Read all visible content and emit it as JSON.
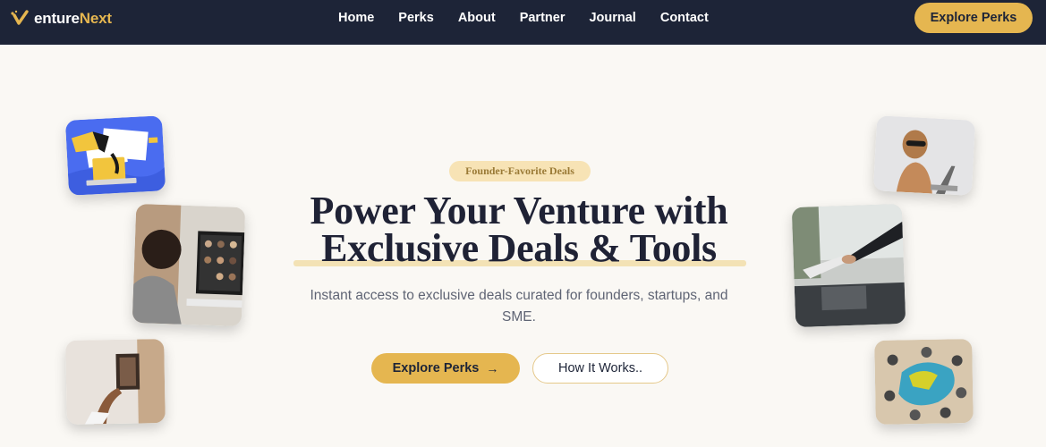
{
  "brand": {
    "name_prefix": "enture",
    "name_suffix": "Next"
  },
  "nav": {
    "links": [
      "Home",
      "Perks",
      "About",
      "Partner",
      "Journal",
      "Contact"
    ],
    "cta_label": "Explore Perks"
  },
  "hero": {
    "badge": "Founder-Favorite Deals",
    "headline_line1": "Power Your Venture with",
    "headline_line2": "Exclusive Deals & Tools",
    "subtitle_line1": "Instant access to exclusive deals curated for founders, startups, and",
    "subtitle_line2": "SME.",
    "primary_button": "Explore Perks",
    "primary_button_icon": "arrow-right-icon",
    "secondary_button": "How It Works.."
  },
  "colors": {
    "nav_bg": "#1d2437",
    "accent": "#e5b650",
    "page_bg": "#faf8f4",
    "badge_bg": "#f7e3b5",
    "heading": "#1f2235"
  }
}
